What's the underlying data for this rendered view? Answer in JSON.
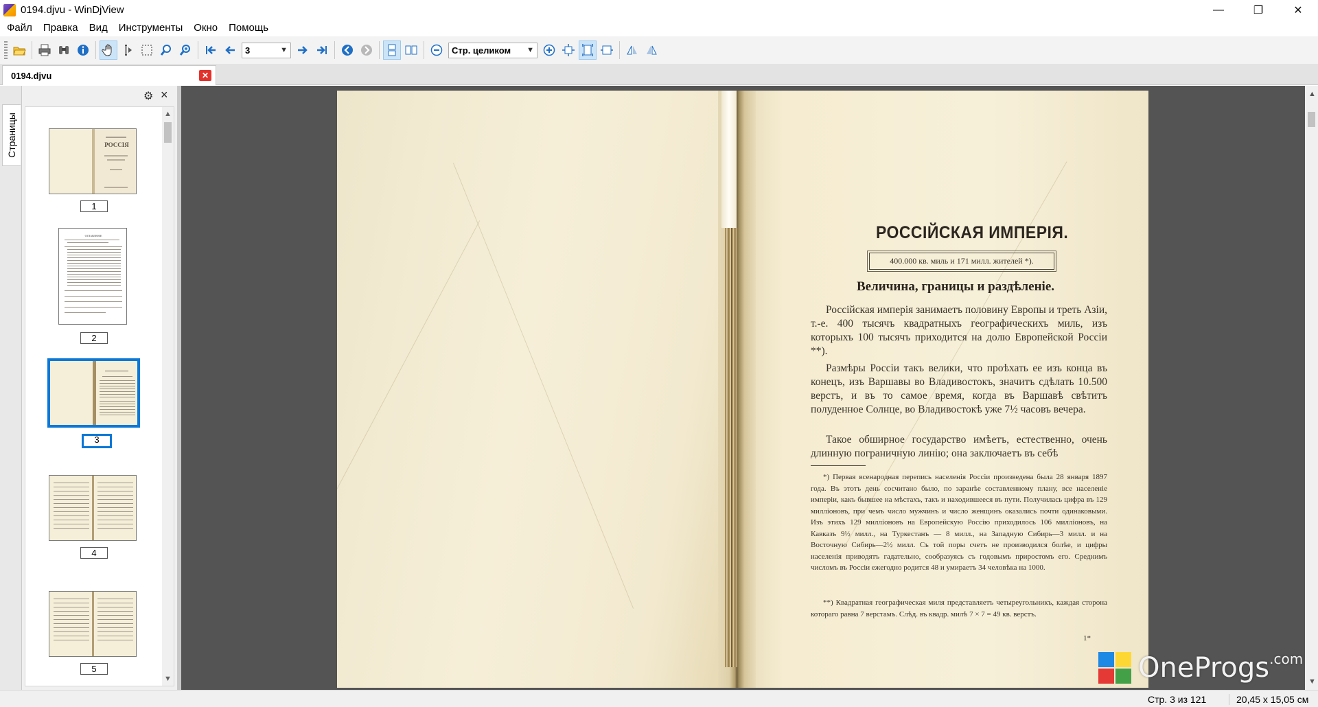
{
  "window": {
    "title": "0194.djvu - WinDjView",
    "minimize": "—",
    "restore": "❐",
    "close": "✕"
  },
  "menu": [
    "Файл",
    "Правка",
    "Вид",
    "Инструменты",
    "Окно",
    "Помощь"
  ],
  "toolbar": {
    "page_value": "3",
    "zoom_value": "Стр. целиком",
    "icons": [
      "open-icon",
      "print-icon",
      "find-icon",
      "info-icon",
      "hand-icon",
      "text-select-icon",
      "rect-select-icon",
      "zoom-rect-icon",
      "magnify-icon",
      "first-page-icon",
      "prev-page-icon",
      "next-page-icon",
      "last-page-icon",
      "back-icon",
      "forward-icon",
      "continuous-icon",
      "facing-icon",
      "zoom-out-icon",
      "zoom-in-icon",
      "actual-size-icon",
      "fit-page-icon",
      "fit-width-icon",
      "rotate-left-icon",
      "rotate-right-icon"
    ]
  },
  "tab": {
    "label": "0194.djvu",
    "close": "✕"
  },
  "sidebar": {
    "vertical_tab": "Страницы",
    "thumbnails": [
      {
        "num": "1",
        "selected": false
      },
      {
        "num": "2",
        "selected": false
      },
      {
        "num": "3",
        "selected": true
      },
      {
        "num": "4",
        "selected": false
      },
      {
        "num": "5",
        "selected": false
      }
    ],
    "thumb1_title": "РОССІЯ",
    "thumb2_title": "ОГЛАВЛЕНІЕ"
  },
  "page": {
    "title": "РОССІЙСКАЯ ИМПЕРІЯ.",
    "box": "400.000 кв. миль и 171 милл. жителей *).",
    "subtitle": "Величина, границы и раздѣленіе.",
    "para1": "Россійская имперія занимаетъ половину Европы и треть Азіи, т.-е. 400 тысячъ квадратныхъ географическихъ миль, изъ которыхъ 100 тысячъ приходится на долю Европейской Россіи **).",
    "para2": "Размѣры Россіи такъ велики, что проѣхать ее изъ конца въ конецъ, изъ Варшавы во Владивостокъ, значитъ сдѣлать 10.500 верстъ, и въ то самое время, когда въ Варшавѣ свѣтитъ полуденное Солнце, во Владивостокѣ уже 7½ часовъ вечера.",
    "para3": "Такое обширное государство имѣетъ, естественно, очень длинную пограничную линію; она заключаетъ въ себѣ",
    "foot1": "*) Первая всенародная перепись населенія Россіи произведена была 28 января 1897 года. Въ этотъ день сосчитано было, по заранѣе составленному плану, все населеніе имперіи, какъ бывшее на мѣстахъ, такъ и находившееся въ пути. Получилась цифра въ 129 милліоновъ, при чемъ число мужчинъ и число женщинъ оказались почти одинаковыми. Изъ этихъ 129 милліоновъ на Европейскую Россію приходилось 106 милліоновъ, на Кавказъ 9½ милл., на Туркестанъ — 8 милл., на Западную Сибирь—3 милл. и на Восточную Сибирь—2½ милл. Съ той поры счетъ не производился болѣе, и цифры населенія приводятъ гадательно, сообразуясь съ годовымъ приростомъ его. Среднимъ числомъ въ Россіи ежегодно родится 48 и умираетъ 34 человѣка на 1000.",
    "foot2": "**) Квадратная географическая миля представляетъ четыреугольникъ, каждая сторона котораго равна 7 верстамъ. Слѣд. въ квадр. милѣ 7 × 7 = 49 кв. верстъ.",
    "page_mark": "1*"
  },
  "watermark": {
    "text": "OneProgs",
    "suffix": ".com"
  },
  "status": {
    "page": "Стр. 3 из 121",
    "size": "20,45 x 15,05 см"
  },
  "colors": {
    "selection": "#0a78d7",
    "viewer_bg": "#545454",
    "paper": "#f5ecd1"
  }
}
